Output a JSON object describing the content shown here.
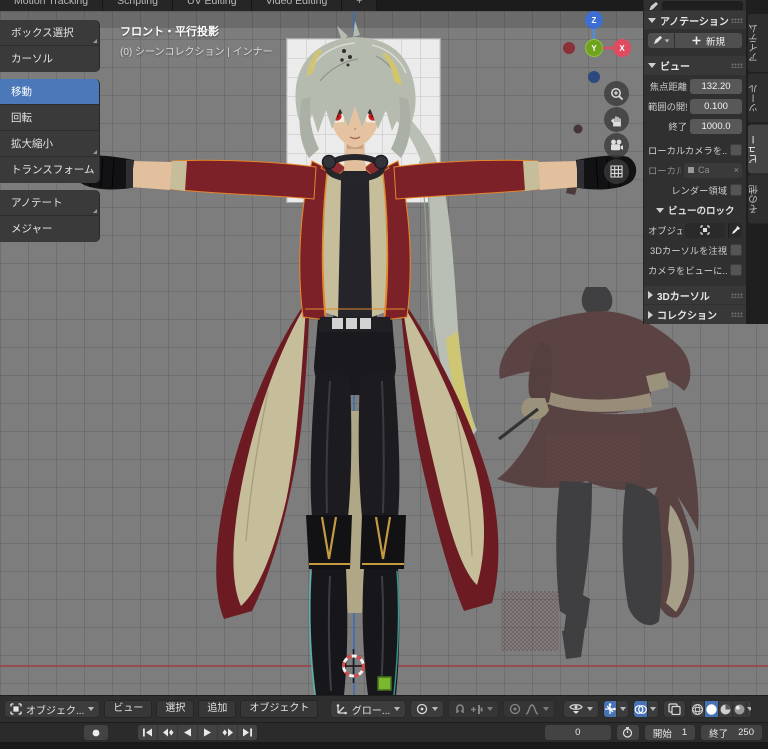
{
  "menubar": {
    "tabs": [
      {
        "label": "Motion Tracking"
      },
      {
        "label": "Scripting"
      },
      {
        "label": "UV Editing"
      },
      {
        "label": "Video Editing"
      },
      {
        "label": "+"
      }
    ]
  },
  "toolbar": {
    "items": [
      {
        "label": "ボックス選択"
      },
      {
        "label": "カーソル"
      },
      {
        "label": "移動"
      },
      {
        "label": "回転"
      },
      {
        "label": "拡大縮小"
      },
      {
        "label": "トランスフォーム"
      },
      {
        "label": "アノテート"
      },
      {
        "label": "メジャー"
      }
    ],
    "active_tool": "移動"
  },
  "viewport": {
    "view_label": "フロント・平行投影",
    "collection_label": "(0) シーンコレクション | インナー",
    "gizmo_axes": {
      "x": "X",
      "y": "Y",
      "z": "Z"
    }
  },
  "sidebar": {
    "tabs": [
      {
        "label": "アイテム"
      },
      {
        "label": "ツール"
      },
      {
        "label": "ビュー"
      },
      {
        "label": "その他"
      }
    ],
    "active_tab": "ビュー",
    "annotation": {
      "title": "アノテーション",
      "new_label": "新規"
    },
    "view_panel": {
      "title": "ビュー",
      "focal_label": "焦点距離",
      "focal_value": "132.20",
      "clip_start_label": "範囲の開始",
      "clip_start_value": "0.100",
      "clip_end_label": "終了",
      "clip_end_value": "1000.0",
      "local_camera_label": "ローカルカメラを...",
      "local_label": "ローカル...",
      "local_value": "Ca",
      "clear_icon": "×",
      "render_region_label": "レンダー領域",
      "view_lock_title": "ビューのロック",
      "lock_object_label": "オブジェ...",
      "lock_cursor_label": "3Dカーソルを注視",
      "camera_to_view_label": "カメラをビューに..."
    },
    "cursor_panel_title": "3Dカーソル",
    "collections_panel_title": "コレクション"
  },
  "footer": {
    "mode_label": "オブジェク...",
    "menus": [
      {
        "label": "ビュー"
      },
      {
        "label": "選択"
      },
      {
        "label": "追加"
      },
      {
        "label": "オブジェクト"
      }
    ],
    "orientation_label": "グロー..."
  },
  "timeline": {
    "current_frame": "0",
    "start_label": "開始",
    "start_value": "1",
    "end_label": "終了",
    "end_value": "250"
  },
  "colors": {
    "accent_blue": "#4772b3",
    "axis_x_red": "#bc4252",
    "axis_z_blue": "#3b6fd2",
    "gizmo_y_green": "#6fa21e",
    "selection_orange": "#e8842c",
    "viewport_gray": "#7d7d7d"
  }
}
